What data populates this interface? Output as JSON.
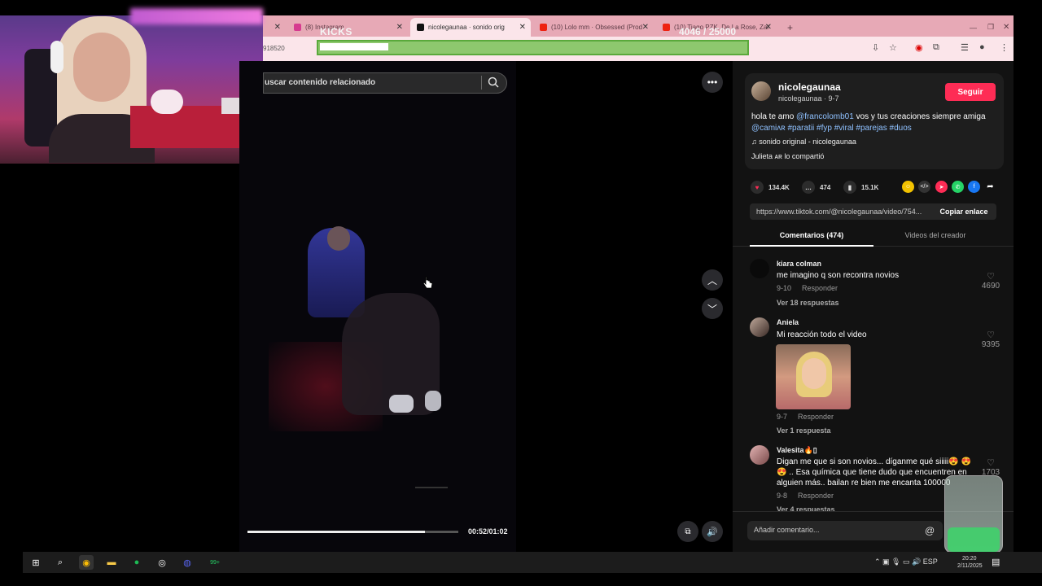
{
  "browser": {
    "tabs": [
      {
        "label": "",
        "active": false
      },
      {
        "label": "(8) Instagram",
        "active": false
      },
      {
        "label": "nicolegaunaa · sonido orig",
        "active": true
      },
      {
        "label": "(10) Lolo mm · Obsessed (Prod",
        "active": false
      },
      {
        "label": "(10) Tiago PZK, De La Rose, Zai",
        "active": false
      }
    ],
    "new_tab": "+",
    "url_stub": "918520"
  },
  "stream_overlay": {
    "kicks_label": "KICKS",
    "goal_counter": "4046 / 25000",
    "goal_progress_fraction": 0.16
  },
  "video": {
    "search_placeholder": "uscar contenido relacionado",
    "time": "00:52/01:02",
    "progress_fraction": 0.84
  },
  "post": {
    "username": "nicolegaunaa",
    "subname": "nicolegaunaa · 9-7",
    "follow_label": "Seguir",
    "caption_text": "hola te amo ",
    "caption_mention": "@francolomb01",
    "caption_mid": " vos y tus creaciones siempre amiga ",
    "caption_tags": "@camiʌʀ #paratii #fyp #viral #parejas #duos",
    "sound": "♫  sonido original - nicolegaunaa",
    "shared": "Julieta ᴀʀ lo compartió",
    "likes": "134.4K",
    "comments": "474",
    "saves": "15.1K",
    "link": "https://www.tiktok.com/@nicolegaunaa/video/754...",
    "copy_label": "Copiar enlace"
  },
  "tabs": {
    "comments": "Comentarios (474)",
    "videos": "Videos del creador"
  },
  "comments": [
    {
      "name": "kiara colman",
      "text": "me imagino q son recontra novios",
      "date": "9-10",
      "reply": "Responder",
      "replies": "Ver 18 respuestas",
      "likes": "4690"
    },
    {
      "name": "Aniela",
      "text": "Mi reacción todo el video",
      "date": "9-7",
      "reply": "Responder",
      "replies": "Ver 1 respuesta",
      "likes": "9395"
    },
    {
      "name": "Valesita🔥▯",
      "text": "Digan me que si son novios... díganme qué siiiii😍 😍 😍 .. Esa química que tiene dudo que encuentren en alguien más.. bailan re bien me encanta 100000",
      "date": "9-8",
      "reply": "Responder",
      "replies": "Ver 4 respuestas",
      "likes": "1703"
    }
  ],
  "add_comment_placeholder": "Añadir comentario...",
  "taskbar": {
    "lang": "ESP",
    "time": "20:20",
    "date": "2/11/2025",
    "badge": "99+"
  },
  "colors": {
    "accent": "#fe2c55",
    "tag": "#8fc1ff",
    "tabbar": "#e7a9b6"
  }
}
